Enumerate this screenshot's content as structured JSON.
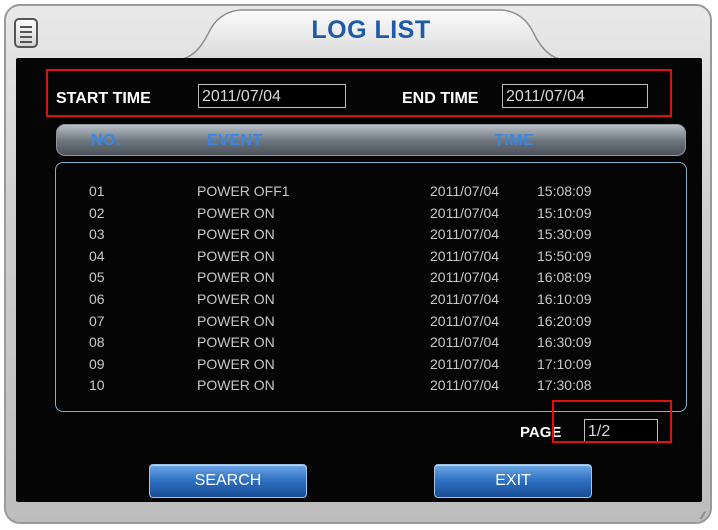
{
  "window": {
    "title": "LOG LIST",
    "icon": "menu-icon"
  },
  "filters": {
    "start_label": "START TIME",
    "start_value": "2011/07/04",
    "end_label": "END TIME",
    "end_value": "2011/07/04"
  },
  "table": {
    "headers": {
      "no": "NO.",
      "event": "EVENT",
      "time": "TIME"
    },
    "rows": [
      {
        "no": "01",
        "event": "POWER OFF1",
        "date": "2011/07/04",
        "time": "15:08:09"
      },
      {
        "no": "02",
        "event": "POWER ON",
        "date": "2011/07/04",
        "time": "15:10:09"
      },
      {
        "no": "03",
        "event": "POWER ON",
        "date": "2011/07/04",
        "time": "15:30:09"
      },
      {
        "no": "04",
        "event": "POWER ON",
        "date": "2011/07/04",
        "time": "15:50:09"
      },
      {
        "no": "05",
        "event": "POWER ON",
        "date": "2011/07/04",
        "time": "16:08:09"
      },
      {
        "no": "06",
        "event": "POWER ON",
        "date": "2011/07/04",
        "time": "16:10:09"
      },
      {
        "no": "07",
        "event": "POWER ON",
        "date": "2011/07/04",
        "time": "16:20:09"
      },
      {
        "no": "08",
        "event": "POWER ON",
        "date": "2011/07/04",
        "time": "16:30:09"
      },
      {
        "no": "09",
        "event": "POWER ON",
        "date": "2011/07/04",
        "time": "17:10:09"
      },
      {
        "no": "10",
        "event": "POWER ON",
        "date": "2011/07/04",
        "time": "17:30:08"
      }
    ]
  },
  "pager": {
    "label": "PAGE",
    "value": "1/2"
  },
  "buttons": {
    "search": "SEARCH",
    "exit": "EXIT"
  },
  "colors": {
    "title": "#1e5aa6",
    "header_text": "#3b86e0",
    "highlight": "#e01010",
    "button": "#2c6ec0"
  }
}
